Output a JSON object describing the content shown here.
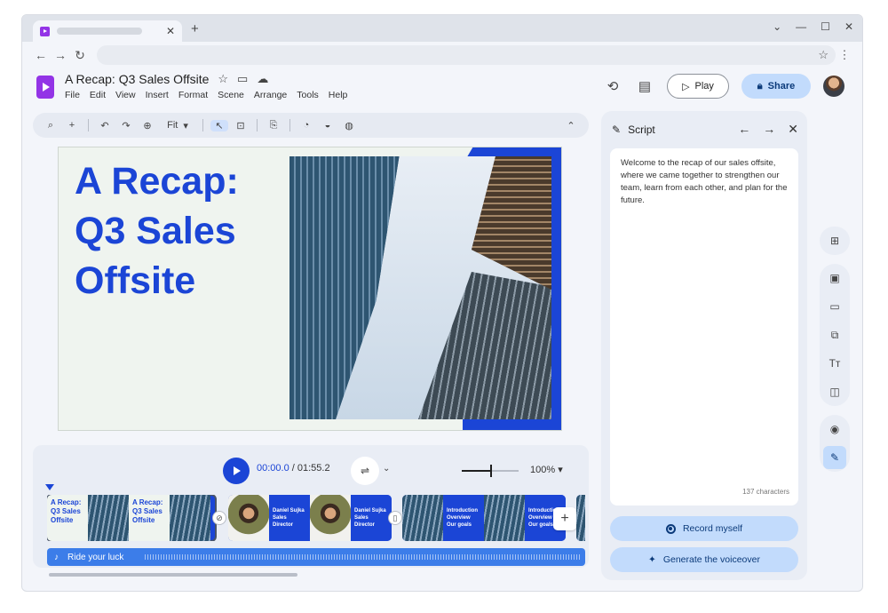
{
  "browser": {
    "omnibox_star": "☆"
  },
  "app": {
    "title": "A Recap: Q3 Sales Offsite",
    "menu": [
      "File",
      "Edit",
      "View",
      "Insert",
      "Format",
      "Scene",
      "Arrange",
      "Tools",
      "Help"
    ],
    "play_label": "Play",
    "share_label": "Share",
    "accent_color": "#1b45d6"
  },
  "toolbar": {
    "zoom_label": "Fit"
  },
  "slide": {
    "title_lines": [
      "A Recap:",
      "Q3 Sales",
      "Offsite"
    ]
  },
  "timeline": {
    "current_time": "00:00.0",
    "separator": " / ",
    "total_time": "01:55.2",
    "zoom": "100%",
    "zoom_level_fraction": 0.5,
    "scenes": [
      {
        "title_lines": [
          "A Recap:",
          "Q3 Sales",
          "Offsite"
        ]
      },
      {
        "title_lines": [
          "A Recap:",
          "Q3 Sales",
          "Offsite"
        ]
      },
      {
        "title_lines": [
          "Daniel Sujka",
          "Sales Director"
        ]
      },
      {
        "title_lines": [
          "Daniel Sujka",
          "Sales Director"
        ]
      },
      {
        "title_lines": [
          "Introduction",
          "Overview",
          "Our goals"
        ]
      },
      {
        "title_lines": [
          "Introduction",
          "Overview",
          "Our goals"
        ]
      }
    ],
    "audio_track": "Ride your luck"
  },
  "script": {
    "header": "Script",
    "text": "Welcome to the recap of our sales offsite, where we came together to strengthen our team, learn from each other, and plan for the future.",
    "char_count": "137 characters",
    "record_label": "Record myself",
    "generate_label": "Generate the voiceover"
  }
}
